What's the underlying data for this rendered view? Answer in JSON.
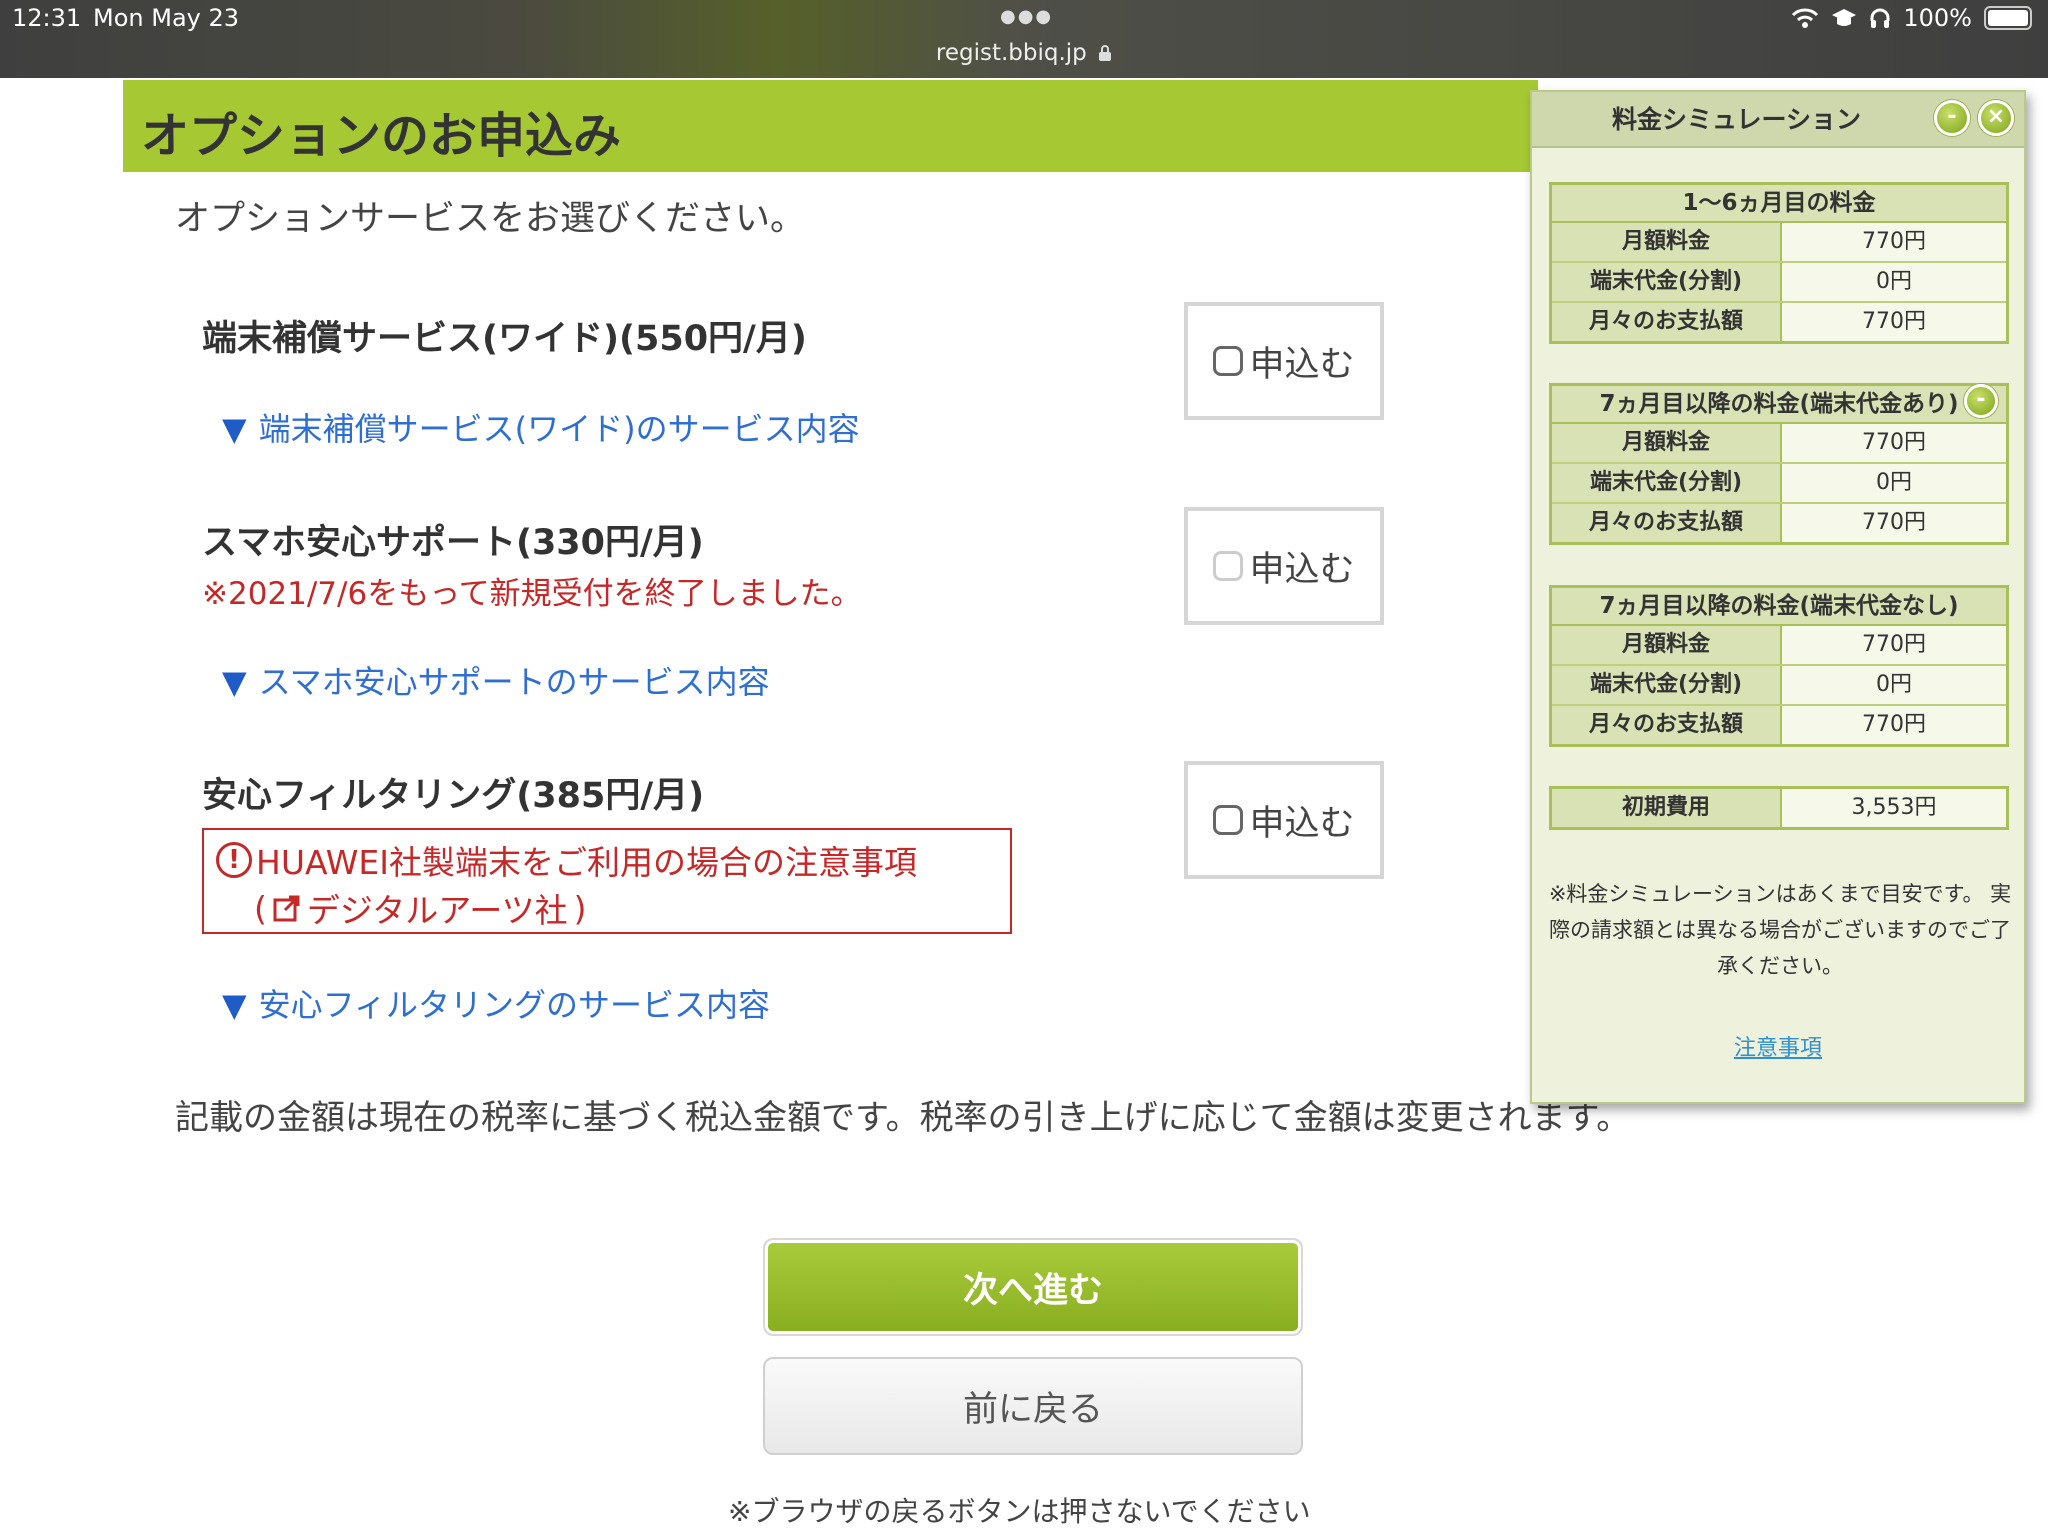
{
  "status_bar": {
    "time": "12:31",
    "date": "Mon May 23",
    "url": "regist.bbiq.jp",
    "battery": "100%"
  },
  "page": {
    "title": "オプションのお申込み",
    "intro": "オプションサービスをお選びください。",
    "services": [
      {
        "title": "端末補償サービス(ワイド)(550円/月)",
        "link": "端末補償サービス(ワイド)のサービス内容",
        "apply_label": "申込む"
      },
      {
        "title": "スマホ安心サポート(330円/月)",
        "notice": "※2021/7/6をもって新規受付を終了しました。",
        "link": "スマホ安心サポートのサービス内容",
        "apply_label": "申込む"
      },
      {
        "title": "安心フィルタリング(385円/月)",
        "huawei_notice": "HUAWEI社製端末をご利用の場合の注意事項",
        "huawei_sub": "デジタルアーツ社",
        "link": "安心フィルタリングのサービス内容",
        "apply_label": "申込む"
      }
    ],
    "tax_note": "記載の金額は現在の税率に基づく税込金額です。税率の引き上げに応じて金額は変更されます。",
    "next_button": "次へ進む",
    "back_button": "前に戻る",
    "browser_note": "※ブラウザの戻るボタンは押さないでください"
  },
  "simulation": {
    "title": "料金シミュレーション",
    "minimize": "-",
    "close": "×",
    "tables": [
      {
        "header": "1〜6ヵ月目の料金",
        "rows": [
          {
            "label": "月額料金",
            "value": "770円"
          },
          {
            "label": "端末代金(分割)",
            "value": "0円"
          },
          {
            "label": "月々のお支払額",
            "value": "770円"
          }
        ]
      },
      {
        "header": "7ヵ月目以降の料金(端末代金あり)",
        "rows": [
          {
            "label": "月額料金",
            "value": "770円"
          },
          {
            "label": "端末代金(分割)",
            "value": "0円"
          },
          {
            "label": "月々のお支払額",
            "value": "770円"
          }
        ]
      },
      {
        "header": "7ヵ月目以降の料金(端末代金なし)",
        "rows": [
          {
            "label": "月額料金",
            "value": "770円"
          },
          {
            "label": "端末代金(分割)",
            "value": "0円"
          },
          {
            "label": "月々のお支払額",
            "value": "770円"
          }
        ]
      }
    ],
    "initial_fee": {
      "label": "初期費用",
      "value": "3,553円"
    },
    "note": "※料金シミュレーションはあくまで目安です。 実際の請求額とは異なる場合がございますのでご了承ください。",
    "link": "注意事項"
  },
  "colors": {
    "accent_green": "#a6c832",
    "link_blue": "#2f6fd1",
    "warning_red": "#c62828"
  }
}
